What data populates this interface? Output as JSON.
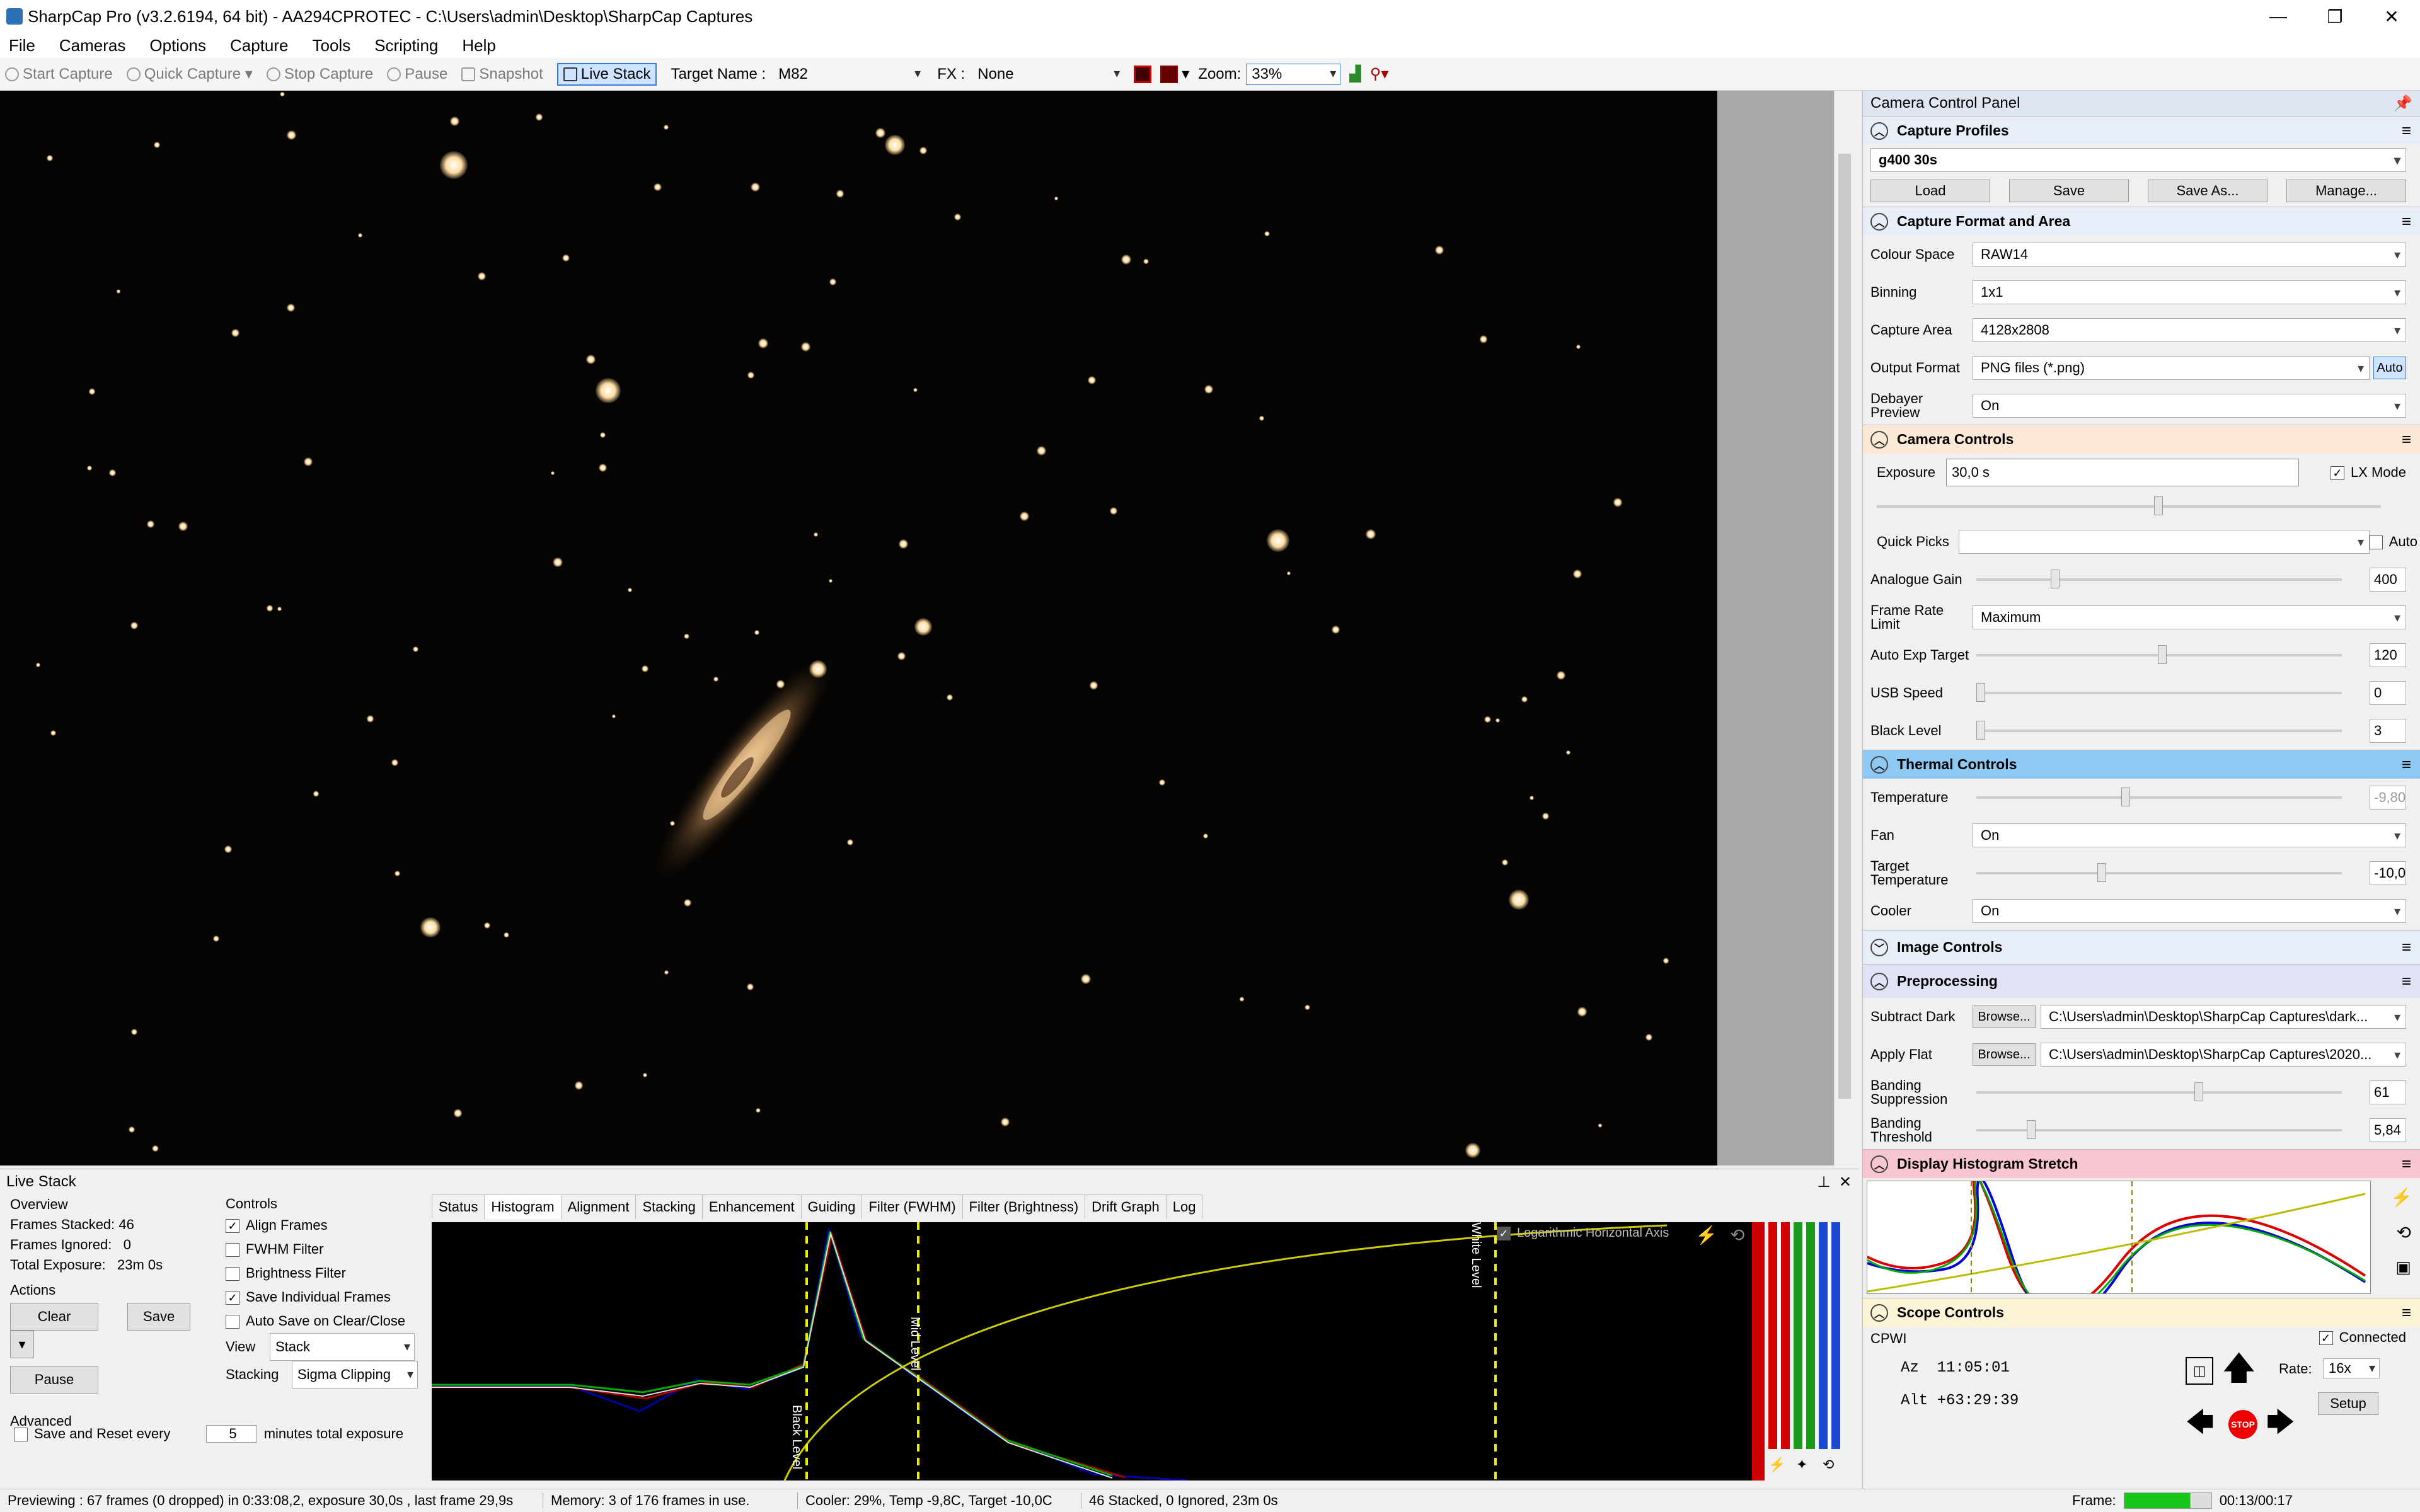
{
  "window": {
    "title": "SharpCap Pro (v3.2.6194, 64 bit) - AA294CPROTEC - C:\\Users\\admin\\Desktop\\SharpCap Captures",
    "controls": [
      "—",
      "❐",
      "✕"
    ]
  },
  "menu": [
    "File",
    "Cameras",
    "Options",
    "Capture",
    "Tools",
    "Scripting",
    "Help"
  ],
  "toolbar": {
    "start_capture": "Start Capture",
    "quick_capture": "Quick Capture",
    "stop_capture": "Stop Capture",
    "pause": "Pause",
    "snapshot": "Snapshot",
    "live_stack": "Live Stack",
    "target_label": "Target Name :",
    "target_value": "M82",
    "fx_label": "FX :",
    "fx_value": "None",
    "zoom_label": "Zoom:",
    "zoom_value": "33%"
  },
  "panel": {
    "title": "Camera Control Panel",
    "capture_profiles": {
      "title": "Capture Profiles",
      "profile": "g400 30s",
      "buttons": [
        "Load",
        "Save",
        "Save As...",
        "Manage..."
      ]
    },
    "format": {
      "title": "Capture Format and Area",
      "colour_space_label": "Colour Space",
      "colour_space": "RAW14",
      "binning_label": "Binning",
      "binning": "1x1",
      "area_label": "Capture Area",
      "area": "4128x2808",
      "output_label": "Output Format",
      "output": "PNG files (*.png)",
      "auto": "Auto",
      "debayer_label": "Debayer Preview",
      "debayer": "On"
    },
    "camera": {
      "title": "Camera Controls",
      "exposure_label": "Exposure",
      "exposure": "30,0 s",
      "lx_mode": "LX Mode",
      "quick_picks": "Quick Picks",
      "auto": "Auto",
      "gain_label": "Analogue Gain",
      "gain": "400",
      "frame_rate_label": "Frame Rate Limit",
      "frame_rate": "Maximum",
      "auto_exp_label": "Auto Exp Target",
      "auto_exp": "120",
      "usb_label": "USB Speed",
      "usb": "0",
      "black_label": "Black Level",
      "black": "3"
    },
    "thermal": {
      "title": "Thermal Controls",
      "temp_label": "Temperature",
      "temp": "-9,80",
      "fan_label": "Fan",
      "fan": "On",
      "target_label": "Target Temperature",
      "target": "-10,0",
      "cooler_label": "Cooler",
      "cooler": "On"
    },
    "image_controls": {
      "title": "Image Controls"
    },
    "preprocessing": {
      "title": "Preprocessing",
      "dark_label": "Subtract Dark",
      "dark_path": "C:\\Users\\admin\\Desktop\\SharpCap Captures\\dark...",
      "flat_label": "Apply Flat",
      "flat_path": "C:\\Users\\admin\\Desktop\\SharpCap Captures\\2020...",
      "browse": "Browse...",
      "banding_label": "Banding Suppression",
      "banding": "61",
      "threshold_label": "Banding Threshold",
      "threshold": "5,84"
    },
    "histogram": {
      "title": "Display Histogram Stretch"
    },
    "scope": {
      "title": "Scope Controls",
      "name": "CPWI",
      "connected": "Connected",
      "az": "Az  11:05:01",
      "alt": "Alt +63:29:39",
      "rate_label": "Rate:",
      "rate": "16x",
      "setup": "Setup",
      "stop": "STOP"
    }
  },
  "live_stack": {
    "title": "Live Stack",
    "overview": "Overview",
    "frames_stacked": "Frames Stacked: 46",
    "frames_ignored": "Frames Ignored:   0",
    "total_exposure": "Total Exposure:   23m 0s",
    "actions": "Actions",
    "clear": "Clear",
    "save": "Save",
    "pause": "Pause",
    "controls": "Controls",
    "align": "Align Frames",
    "fwhm": "FWHM Filter",
    "brightness": "Brightness Filter",
    "save_individual": "Save Individual Frames",
    "auto_save": "Auto Save on Clear/Close",
    "view_label": "View",
    "view": "Stack",
    "stacking_label": "Stacking",
    "stacking": "Sigma Clipping",
    "advanced": "Advanced",
    "save_reset": "Save and Reset every",
    "minutes": "5",
    "minutes_suffix": "minutes total exposure",
    "tabs": [
      "Status",
      "Histogram",
      "Alignment",
      "Stacking",
      "Enhancement",
      "Guiding",
      "Filter (FWHM)",
      "Filter (Brightness)",
      "Drift Graph",
      "Log"
    ],
    "log_axis": "Logarithmic Horizontal Axis",
    "black_level": "Black Level",
    "mid_level": "Mid Level",
    "white_level": "White Level"
  },
  "status": {
    "preview": "Previewing : 67 frames (0 dropped) in 0:33:08,2, exposure 30,0s , last frame 29,9s",
    "memory": "Memory: 3 of 176 frames in use.",
    "cooler": "Cooler: 29%, Temp -9,8C, Target -10,0C",
    "stacked": "46 Stacked, 0 Ignored, 23m 0s",
    "frame_label": "Frame:",
    "time": "00:13/00:17"
  }
}
